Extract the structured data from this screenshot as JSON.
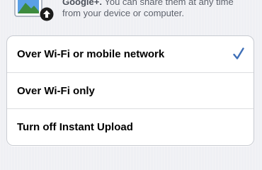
{
  "header": {
    "description_brand": "Google+.",
    "description_line1_rest": " You can share them at any time",
    "description_line2": "from your device or computer.",
    "icons": {
      "photo": "photo-icon",
      "upload": "upload-badge-icon"
    }
  },
  "options": [
    {
      "label": "Over Wi-Fi or mobile network",
      "selected": true
    },
    {
      "label": "Over Wi-Fi only",
      "selected": false
    },
    {
      "label": "Turn off Instant Upload",
      "selected": false
    }
  ],
  "colors": {
    "checkmark": "#3f6fb7",
    "background": "#eff0f4",
    "text_secondary": "#5a5f6a"
  }
}
